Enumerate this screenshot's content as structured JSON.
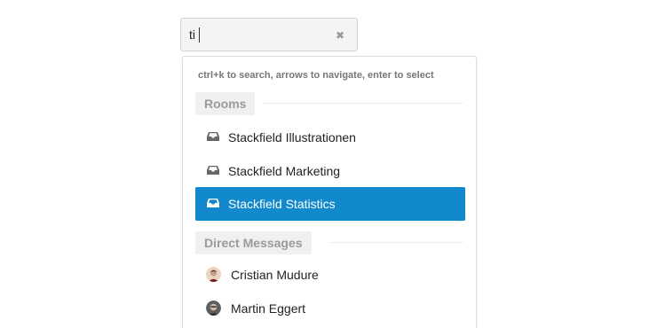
{
  "search": {
    "value": "ti"
  },
  "dropdown": {
    "hint": "ctrl+k to search, arrows to navigate, enter to select",
    "rooms_header": "Rooms",
    "rooms": [
      {
        "label": "Stackfield Illustrationen",
        "icon": "inbox-icon"
      },
      {
        "label": "Stackfield Marketing",
        "icon": "inbox-icon"
      },
      {
        "label": "Stackfield Statistics",
        "icon": "inbox-icon",
        "selected": true
      }
    ],
    "dm_header": "Direct Messages",
    "people": [
      {
        "label": "Cristian Mudure"
      },
      {
        "label": "Martin Eggert"
      }
    ]
  },
  "colors": {
    "accent": "#1289cc"
  }
}
